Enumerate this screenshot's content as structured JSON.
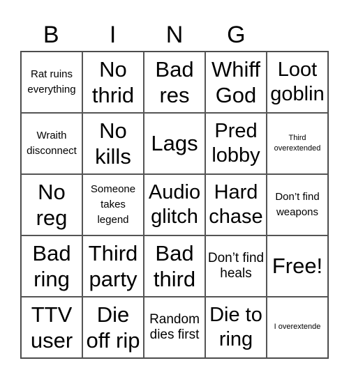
{
  "title": {
    "letters": [
      "B",
      "I",
      "N",
      "G",
      ""
    ]
  },
  "board": {
    "rows": [
      [
        {
          "text": "Rat ruins everything",
          "size": "s"
        },
        {
          "text": "No thrid",
          "size": "xl"
        },
        {
          "text": "Bad res",
          "size": "xl"
        },
        {
          "text": "Whiff God",
          "size": "xl"
        },
        {
          "text": "Loot goblin",
          "size": "l"
        }
      ],
      [
        {
          "text": "Wraith disconnect",
          "size": "s"
        },
        {
          "text": "No kills",
          "size": "xl"
        },
        {
          "text": "Lags",
          "size": "xl"
        },
        {
          "text": "Pred lobby",
          "size": "l"
        },
        {
          "text": "Third overextended",
          "size": "xs"
        }
      ],
      [
        {
          "text": "No reg",
          "size": "xl"
        },
        {
          "text": "Someone takes legend",
          "size": "s"
        },
        {
          "text": "Audio glitch",
          "size": "l"
        },
        {
          "text": "Hard chase",
          "size": "l"
        },
        {
          "text": "Don’t find weapons",
          "size": "s"
        }
      ],
      [
        {
          "text": "Bad ring",
          "size": "xl"
        },
        {
          "text": "Third party",
          "size": "xl"
        },
        {
          "text": "Bad third",
          "size": "xl"
        },
        {
          "text": "Don’t find heals",
          "size": "m"
        },
        {
          "text": "Free!",
          "size": "xl"
        }
      ],
      [
        {
          "text": "TTV user",
          "size": "xl"
        },
        {
          "text": "Die off rip",
          "size": "xl"
        },
        {
          "text": "Random dies first",
          "size": "m"
        },
        {
          "text": "Die to ring",
          "size": "l"
        },
        {
          "text": "I overextende",
          "size": "xs"
        }
      ]
    ]
  }
}
